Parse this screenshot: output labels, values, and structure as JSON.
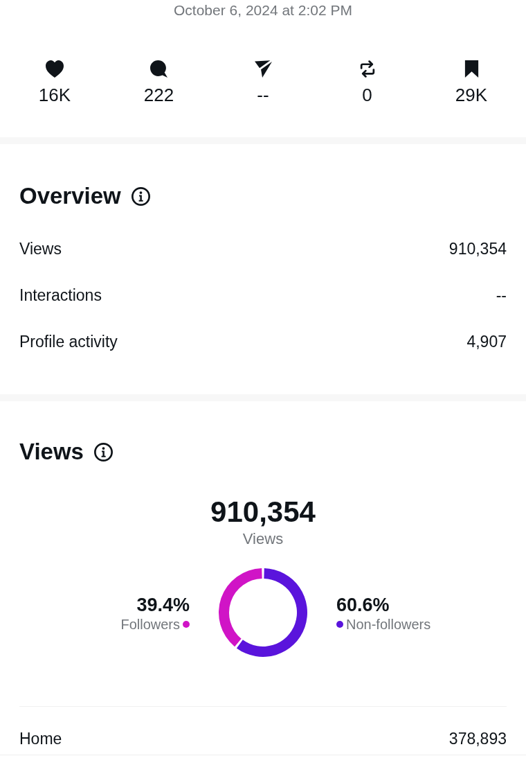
{
  "timestamp": "October 6, 2024 at 2:02 PM",
  "engagement": [
    {
      "kind": "like",
      "value": "16K"
    },
    {
      "kind": "reply",
      "value": "222"
    },
    {
      "kind": "share",
      "value": "--"
    },
    {
      "kind": "repost",
      "value": "0"
    },
    {
      "kind": "bookmark",
      "value": "29K"
    }
  ],
  "overview": {
    "title": "Overview",
    "rows": [
      {
        "label": "Views",
        "value": "910,354"
      },
      {
        "label": "Interactions",
        "value": "--"
      },
      {
        "label": "Profile activity",
        "value": "4,907"
      }
    ]
  },
  "views": {
    "title": "Views",
    "total": "910,354",
    "total_label": "Views",
    "chart_data": {
      "type": "donut",
      "categories": [
        "Followers",
        "Non-followers"
      ],
      "values": [
        39.4,
        60.6
      ],
      "value_labels": [
        "39.4%",
        "60.6%"
      ]
    },
    "legend": [
      {
        "color": "#d014c6"
      },
      {
        "color": "#5a14dc"
      }
    ],
    "rows": [
      {
        "label": "Home",
        "value": "378,893"
      }
    ]
  }
}
